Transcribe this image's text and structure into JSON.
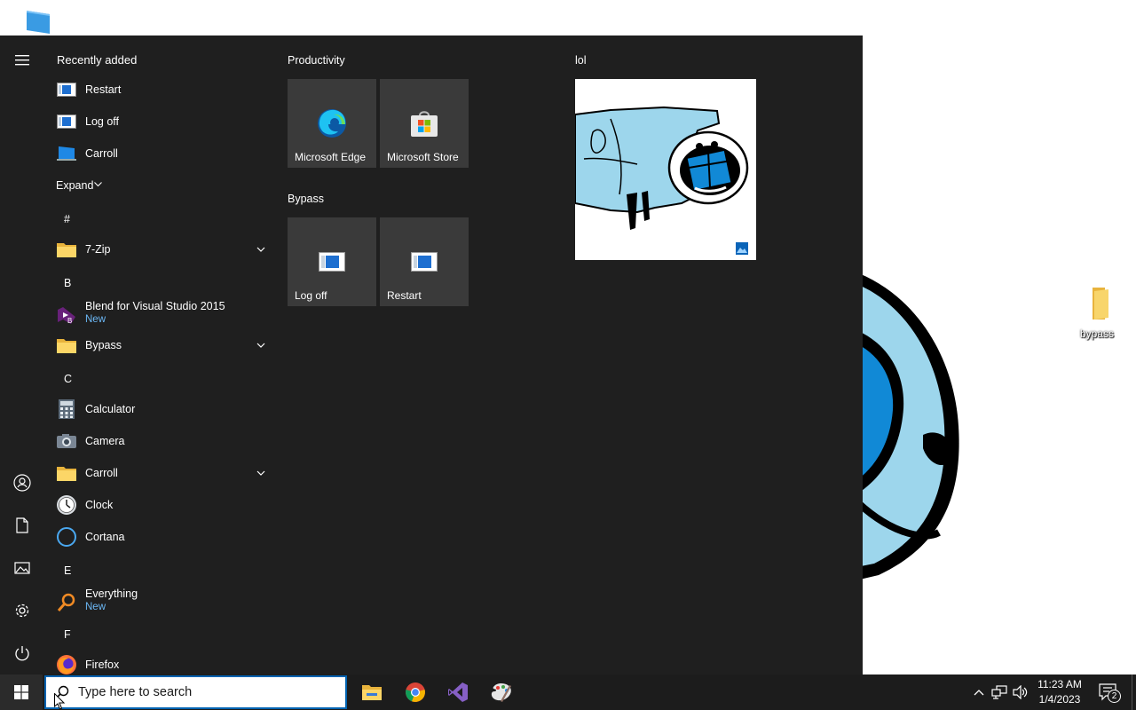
{
  "desktop": {
    "icons": [
      {
        "label": "bypass"
      }
    ]
  },
  "start_menu": {
    "recently_added_title": "Recently added",
    "recent": [
      {
        "label": "Restart"
      },
      {
        "label": "Log off"
      },
      {
        "label": "Carroll"
      }
    ],
    "expand_label": "Expand",
    "letters": [
      "#",
      "B",
      "C",
      "E",
      "F"
    ],
    "apps": [
      {
        "label": "7-Zip",
        "sub": ""
      },
      {
        "label": "Blend for Visual Studio 2015",
        "sub": "New"
      },
      {
        "label": "Bypass",
        "sub": ""
      },
      {
        "label": "Calculator",
        "sub": ""
      },
      {
        "label": "Camera",
        "sub": ""
      },
      {
        "label": "Carroll",
        "sub": ""
      },
      {
        "label": "Clock",
        "sub": ""
      },
      {
        "label": "Cortana",
        "sub": ""
      },
      {
        "label": "Everything",
        "sub": "New"
      },
      {
        "label": "Firefox",
        "sub": ""
      }
    ],
    "groups": [
      {
        "title": "Productivity",
        "tiles": [
          {
            "label": "Microsoft Edge"
          },
          {
            "label": "Microsoft Store"
          }
        ]
      },
      {
        "title": "Bypass",
        "tiles": [
          {
            "label": "Log off"
          },
          {
            "label": "Restart"
          }
        ]
      },
      {
        "title": "lol",
        "tiles": [
          {
            "label": ""
          }
        ]
      }
    ]
  },
  "taskbar": {
    "search_placeholder": "Type here to search",
    "clock_time": "11:23 AM",
    "clock_date": "1/4/2023",
    "notification_count": "2",
    "pinned": [
      {
        "icon": "file-explorer-icon"
      },
      {
        "icon": "chrome-icon"
      },
      {
        "icon": "visual-studio-icon"
      },
      {
        "icon": "paint-icon"
      }
    ]
  },
  "colors": {
    "start_bg": "#1f1f1f",
    "tile_bg": "#3a3a3a",
    "accent": "#0078d7",
    "new_badge": "#6cb8f6"
  }
}
